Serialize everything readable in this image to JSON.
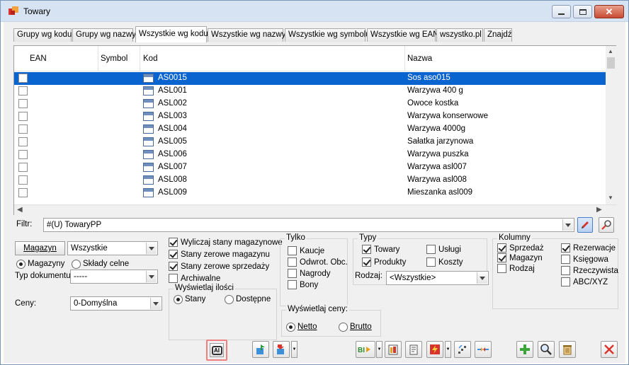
{
  "window": {
    "title": "Towary"
  },
  "tabs": [
    {
      "label": "Grupy wg kodu"
    },
    {
      "label": "Grupy wg nazwy"
    },
    {
      "label": "Wszystkie wg kodu"
    },
    {
      "label": "Wszystkie wg nazwy"
    },
    {
      "label": "Wszystkie wg symbolu"
    },
    {
      "label": "Wszystkie wg EAN"
    },
    {
      "label": "wszystko.pl"
    },
    {
      "label": "Znajdź"
    }
  ],
  "grid": {
    "columns": {
      "ean": "EAN",
      "symbol": "Symbol",
      "kod": "Kod",
      "nazwa": "Nazwa"
    },
    "rows": [
      {
        "kod": "AS0015",
        "nazwa": "Sos aso015"
      },
      {
        "kod": "ASL001",
        "nazwa": "Warzywa 400 g"
      },
      {
        "kod": "ASL002",
        "nazwa": "Owoce kostka"
      },
      {
        "kod": "ASL003",
        "nazwa": "Warzywa konserwowe"
      },
      {
        "kod": "ASL004",
        "nazwa": "Warzywa 4000g"
      },
      {
        "kod": "ASL005",
        "nazwa": "Sałatka jarzynowa"
      },
      {
        "kod": "ASL006",
        "nazwa": "Warzywa puszka"
      },
      {
        "kod": "ASL007",
        "nazwa": "Warzywa asl007"
      },
      {
        "kod": "ASL008",
        "nazwa": "Warzywa asl008"
      },
      {
        "kod": "ASL009",
        "nazwa": "Mieszanka asl009"
      }
    ]
  },
  "filter": {
    "label": "Filtr:",
    "value": "#(U) TowaryPP"
  },
  "magazyn": {
    "button": "Magazyn",
    "value": "Wszystkie",
    "radio_magazyny": "Magazyny",
    "radio_sklady": "Składy celne",
    "typ_label": "Typ dokumentu:",
    "typ_value": "-----",
    "ceny_label": "Ceny:",
    "ceny_value": "0-Domyślna"
  },
  "options": {
    "wyliczaj": "Wyliczaj stany magazynowe",
    "stany_zerowe_mag": "Stany zerowe magazynu",
    "stany_zerowe_sprz": "Stany zerowe sprzedaży",
    "archiwalne": "Archiwalne",
    "wysw_ilosci_title": "Wyświetlaj ilości",
    "stany": "Stany",
    "dostepne": "Dostępne"
  },
  "tylko": {
    "title": "Tylko",
    "kaucje": "Kaucje",
    "odwrot": "Odwrot. Obc.",
    "nagrody": "Nagrody",
    "bony": "Bony"
  },
  "typy": {
    "title": "Typy",
    "towary": "Towary",
    "uslugi": "Usługi",
    "produkty": "Produkty",
    "koszty": "Koszty",
    "rodzaj_label": "Rodzaj:",
    "rodzaj_value": "<Wszystkie>"
  },
  "ceny_wysw": {
    "title": "Wyświetlaj ceny:",
    "netto": "Netto",
    "brutto": "Brutto"
  },
  "kolumny": {
    "title": "Kolumny",
    "sprzedaz": "Sprzedaż",
    "magazyn": "Magazyn",
    "rodzaj": "Rodzaj",
    "rezerwacje": "Rezerwacje",
    "ksiegowa": "Księgowa",
    "rzeczywista": "Rzeczywista",
    "abc": "ABC/XYZ"
  },
  "toolbar": {
    "ai_label": "AI"
  },
  "colors": {
    "selection": "#0a64d0",
    "accent_red": "#d9342b",
    "ai_highlight": "#f08080"
  }
}
